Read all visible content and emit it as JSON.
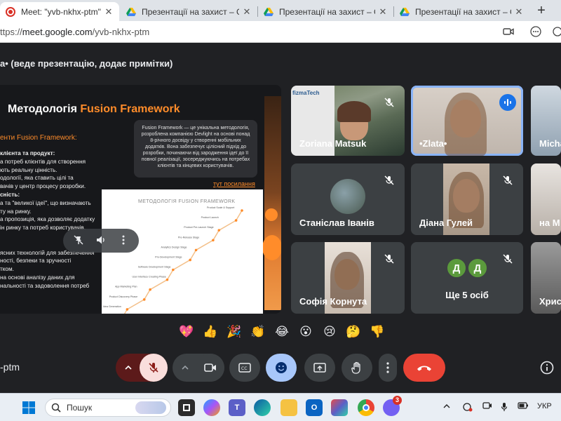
{
  "browser": {
    "tabs": [
      {
        "title": "Meet: \"yvb-nkhx-ptm\"",
        "icon": "record-icon",
        "active": true
      },
      {
        "title": "Презентації на захист – Google",
        "icon": "google-drive-icon",
        "active": false
      },
      {
        "title": "Презентації на захист – Google",
        "icon": "google-drive-icon",
        "active": false
      },
      {
        "title": "Презентації на захист – Google",
        "icon": "google-drive-icon",
        "active": false
      }
    ],
    "new_tab": "+",
    "url_prefix": "ttps://",
    "url_host": "meet.google.com",
    "url_path": "/yvb-nkhx-ptm"
  },
  "meet": {
    "presenting_title": "а• (веде презентацію, додає примітки)",
    "meeting_code": "-ptm",
    "slide": {
      "title_plain": "Методологія ",
      "title_accent": "Fusion Framework",
      "subtitle": "енти Fusion Framework:",
      "lines": [
        {
          "text": "клієнта та продукт:",
          "bold": true
        },
        {
          "text": "а потреб клієнтів для створення",
          "bold": false
        },
        {
          "text": "ють реальну цінність.",
          "bold": false
        },
        {
          "text": "одології, яка ставить цілі та",
          "bold": false
        },
        {
          "text": "вачів у центр процесу розробки.",
          "bold": false
        },
        {
          "text": "сність:",
          "bold": true
        },
        {
          "text": "а та \"великої ідеї\", що визначають",
          "bold": false
        },
        {
          "text": "ту на ринку.",
          "bold": false
        },
        {
          "text": "а пропозиція, яка дозволяє додатку",
          "bold": false
        },
        {
          "text": "ін ринку та потреб користувачів.",
          "bold": false
        },
        {
          "text": "",
          "bold": false
        },
        {
          "text": "",
          "bold": false
        },
        {
          "text": "ясних технологій для забезпечення",
          "bold": false
        },
        {
          "text": "ності, безпеки та зручності",
          "bold": false
        },
        {
          "text": "тком.",
          "bold": false
        },
        {
          "text": "на основі аналізу даних для",
          "bold": false
        },
        {
          "text": "нальності та задоволення потреб",
          "bold": false
        }
      ],
      "box_text": "Fusion Framework — це унікальна методологія, розроблена компанією Devlight на основі понад 8-річного досвіду у створенні мобільних додатків. Вона забезпечує цілісний підхід до розробки, починаючи від зародження ідеї до її повної реалізації, зосереджуючись на потребах клієнтів та кінцевих користувачів.",
      "link_text": "тут посилання",
      "image_label": "МЕТОДОЛОГІЯ FUSION FRAMEWORK",
      "diagram_stages": [
        "Product Scale & Support",
        "Product Launch",
        "Product Pre-Launch Stage",
        "Pre-Release Stage",
        "Analytics Design Stage",
        "Pre-Development Stage",
        "Software Development Stage",
        "User Interface Creating Phase",
        "App Marketing Plan",
        "Product Discovery Phase",
        "Idea Generation",
        "Idea Acceleration"
      ]
    },
    "participants": [
      {
        "name": "Zoriana Matsuk",
        "muted": true,
        "speaking": false,
        "video": "zoriana"
      },
      {
        "name": "•Zlata•",
        "muted": false,
        "speaking": true,
        "video": "zlata"
      },
      {
        "name": "Micha",
        "muted": false,
        "speaking": false,
        "video": "micha"
      },
      {
        "name": "Станіслав Іванів",
        "muted": true,
        "speaking": false,
        "video": "stanislav"
      },
      {
        "name": "Діана Гулей",
        "muted": true,
        "speaking": false,
        "video": "diana"
      },
      {
        "name": "на М",
        "muted": false,
        "speaking": false,
        "video": "anna"
      },
      {
        "name": "Софія Корнута",
        "muted": true,
        "speaking": false,
        "video": "sofia"
      },
      {
        "name": "Ще 5 осіб",
        "muted": true,
        "speaking": false,
        "video": "more",
        "avatars": [
          "Д",
          "Д"
        ]
      },
      {
        "name": "Христ",
        "muted": false,
        "speaking": false,
        "video": "khryst"
      }
    ],
    "zoriana_screen_text": "fizmaTech",
    "reactions": [
      "💖",
      "👍",
      "🎉",
      "👏",
      "😂",
      "😮",
      "😢",
      "🤔",
      "👎"
    ]
  },
  "taskbar": {
    "search_placeholder": "Пошук",
    "language": "УКР",
    "chat_badge": "3",
    "apps": [
      "widgets",
      "files",
      "copilot",
      "teams",
      "edge",
      "explorer",
      "outlook",
      "m365",
      "chrome",
      "viber"
    ]
  },
  "colors": {
    "accent_orange": "#ff8c2a",
    "leave_red": "#ea4335",
    "active_blue": "#8ab4f8",
    "avatar_green": "#5b9a3c"
  }
}
